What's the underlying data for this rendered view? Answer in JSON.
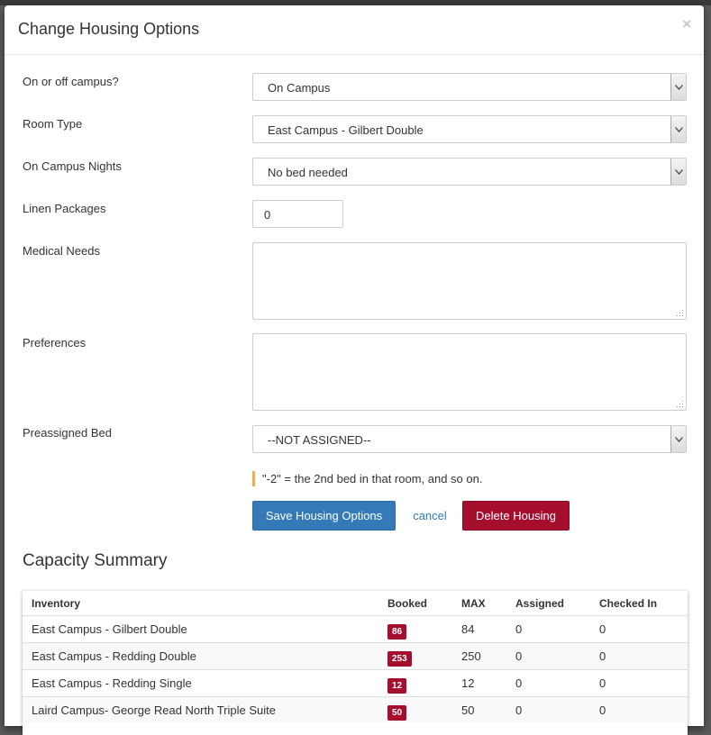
{
  "modal": {
    "title": "Change Housing Options",
    "close_label": "×"
  },
  "form": {
    "campus": {
      "label": "On or off campus?",
      "value": "On Campus"
    },
    "room_type": {
      "label": "Room Type",
      "value": "East Campus - Gilbert Double"
    },
    "nights": {
      "label": "On Campus Nights",
      "value": "No bed needed"
    },
    "linen": {
      "label": "Linen Packages",
      "value": "0"
    },
    "medical": {
      "label": "Medical Needs",
      "value": ""
    },
    "preferences": {
      "label": "Preferences",
      "value": ""
    },
    "bed": {
      "label": "Preassigned Bed",
      "value": "--NOT ASSIGNED--"
    },
    "help_text": "\"-2\" = the 2nd bed in that room, and so on."
  },
  "actions": {
    "save_label": "Save Housing Options",
    "cancel_label": "cancel",
    "delete_label": "Delete Housing"
  },
  "capacity": {
    "title": "Capacity Summary",
    "columns": [
      "Inventory",
      "Booked",
      "MAX",
      "Assigned",
      "Checked In"
    ],
    "rows": [
      {
        "inventory": "East Campus - Gilbert Double",
        "booked": "86",
        "max": "84",
        "assigned": "0",
        "checked_in": "0"
      },
      {
        "inventory": "East Campus - Redding Double",
        "booked": "253",
        "max": "250",
        "assigned": "0",
        "checked_in": "0"
      },
      {
        "inventory": "East Campus - Redding Single",
        "booked": "12",
        "max": "12",
        "assigned": "0",
        "checked_in": "0"
      },
      {
        "inventory": "Laird Campus- George Read North Triple Suite",
        "booked": "50",
        "max": "50",
        "assigned": "0",
        "checked_in": "0"
      }
    ]
  },
  "colors": {
    "primary": "#337ab7",
    "danger": "#a50e2d",
    "help_accent": "#f0ad4e"
  }
}
